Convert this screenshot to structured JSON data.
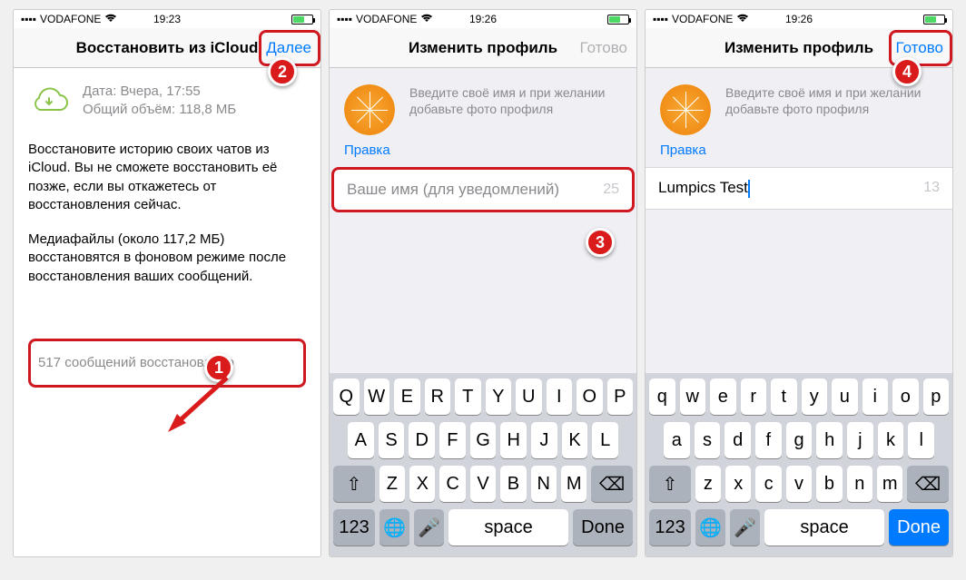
{
  "screen1": {
    "carrier": "VODAFONE",
    "wifi": true,
    "time": "19:23",
    "title": "Восстановить из iCloud",
    "navRight": "Далее",
    "backup": {
      "dateLabel": "Дата: Вчера, 17:55",
      "sizeLabel": "Общий объём: 118,8 МБ"
    },
    "para1": "Восстановите историю своих чатов из iCloud. Вы не сможете восстановить её позже, если вы откажетесь от восстановления сейчас.",
    "para2": "Медиафайлы (около 117,2 МБ) восстановятся в фоновом режиме после восстановления ваших сообщений.",
    "restored": "517 сообщений восстановлено"
  },
  "screen2": {
    "carrier": "VODAFONE",
    "time": "19:26",
    "title": "Изменить профиль",
    "navRight": "Готово",
    "hint": "Введите своё имя и при желании добавьте фото профиля",
    "edit": "Правка",
    "namePlaceholder": "Ваше имя (для уведомлений)",
    "nameValue": "",
    "charCount": "25"
  },
  "screen3": {
    "carrier": "VODAFONE",
    "time": "19:26",
    "title": "Изменить профиль",
    "navRight": "Готово",
    "hint": "Введите своё имя и при желании добавьте фото профиля",
    "edit": "Правка",
    "nameValue": "Lumpics Test",
    "charCount": "13"
  },
  "keyboardUpper": {
    "row1": [
      "Q",
      "W",
      "E",
      "R",
      "T",
      "Y",
      "U",
      "I",
      "O",
      "P"
    ],
    "row2": [
      "A",
      "S",
      "D",
      "F",
      "G",
      "H",
      "J",
      "K",
      "L"
    ],
    "row3": [
      "Z",
      "X",
      "C",
      "V",
      "B",
      "N",
      "M"
    ],
    "shift": "⇧",
    "backspace": "⌫",
    "numKey": "123",
    "globe": "🌐",
    "mic": "🎤",
    "space": "space",
    "done": "Done"
  },
  "keyboardLower": {
    "row1": [
      "q",
      "w",
      "e",
      "r",
      "t",
      "y",
      "u",
      "i",
      "o",
      "p"
    ],
    "row2": [
      "a",
      "s",
      "d",
      "f",
      "g",
      "h",
      "j",
      "k",
      "l"
    ],
    "row3": [
      "z",
      "x",
      "c",
      "v",
      "b",
      "n",
      "m"
    ],
    "shift": "⇧",
    "backspace": "⌫",
    "numKey": "123",
    "globe": "🌐",
    "mic": "🎤",
    "space": "space",
    "done": "Done"
  },
  "annotations": {
    "n1": "1",
    "n2": "2",
    "n3": "3",
    "n4": "4"
  }
}
